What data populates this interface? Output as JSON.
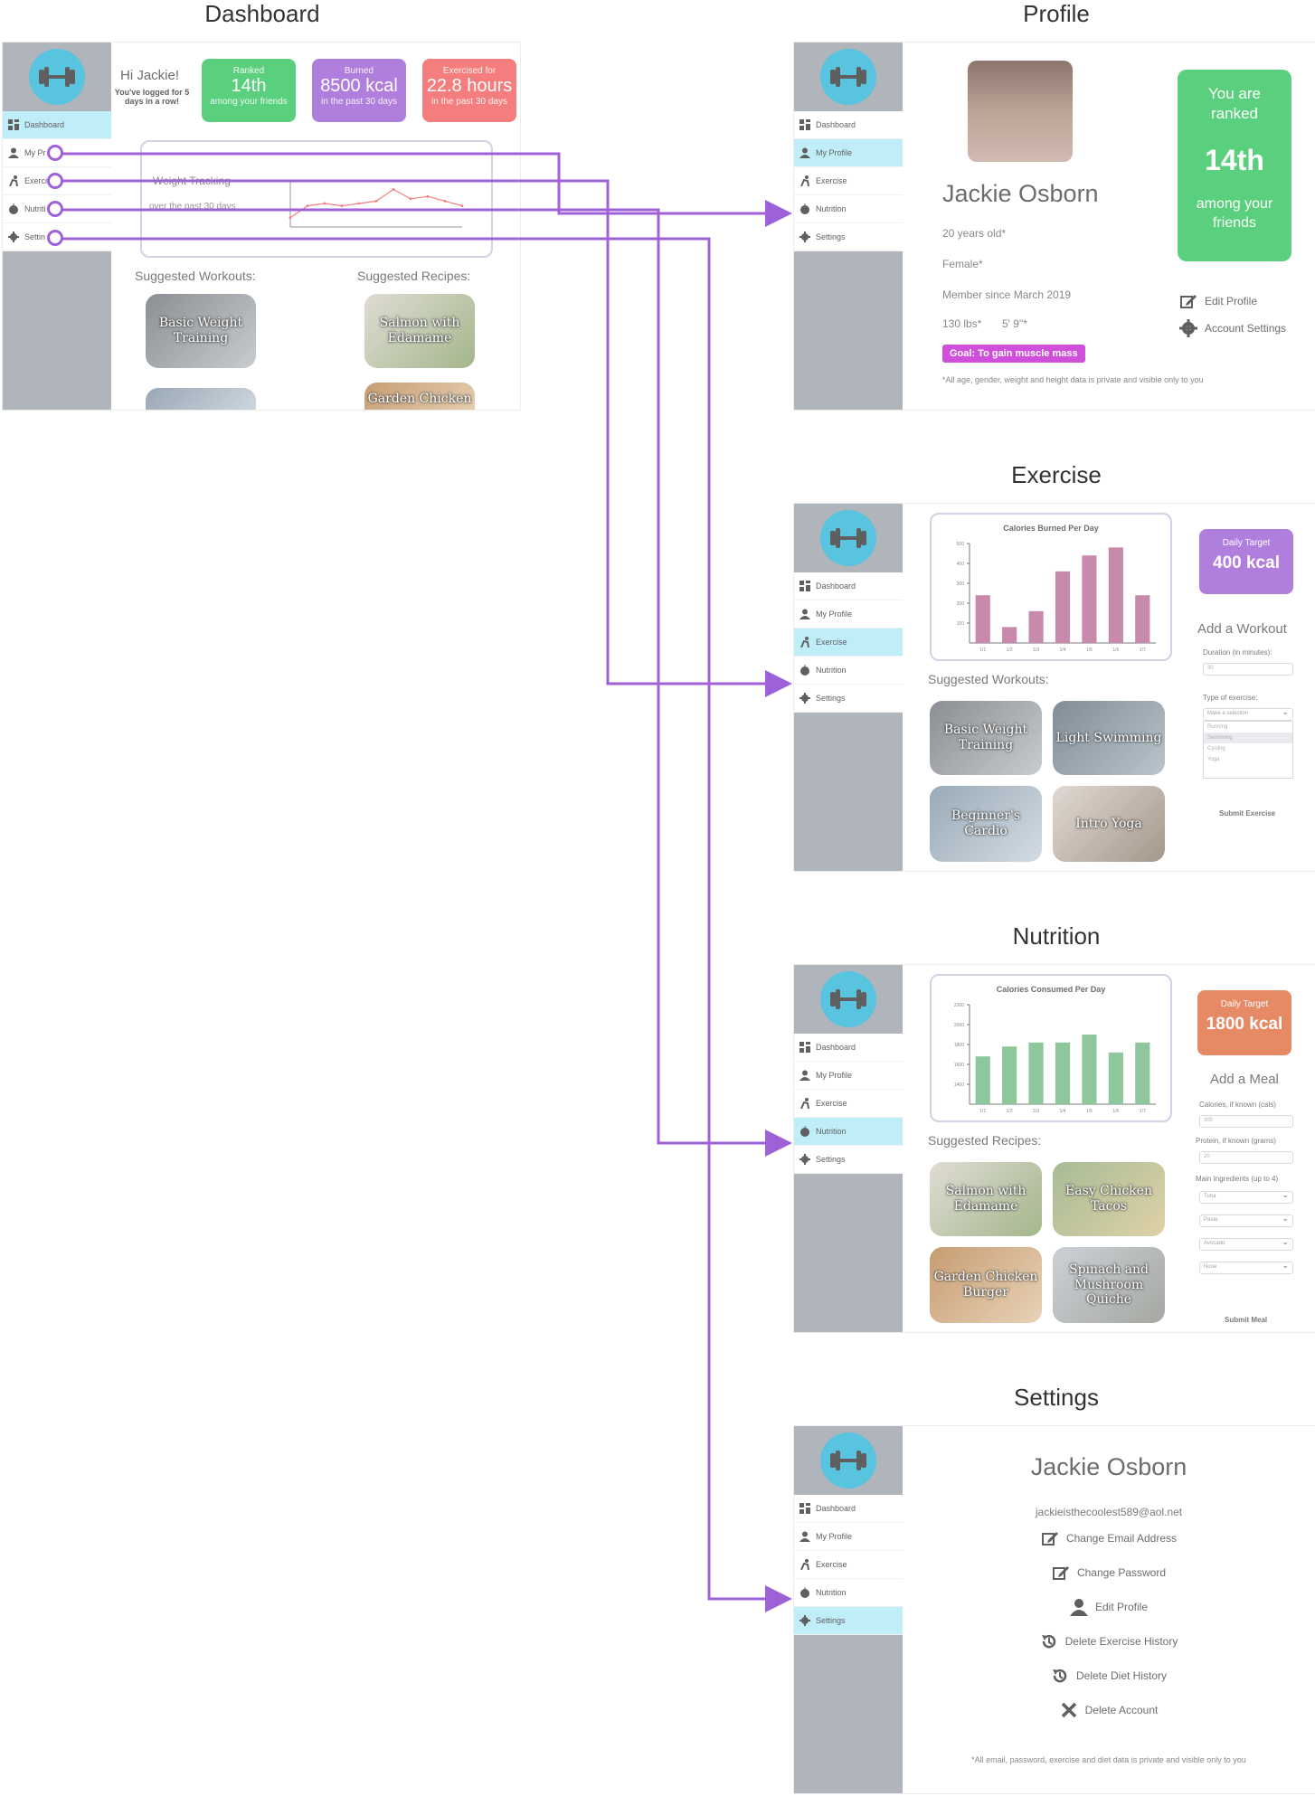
{
  "titles": {
    "dashboard": "Dashboard",
    "profile": "Profile",
    "exercise": "Exercise",
    "nutrition": "Nutrition",
    "settings": "Settings"
  },
  "nav": {
    "dashboard": "Dashboard",
    "profile": "My Profile",
    "exercise": "Exercise",
    "nutrition": "Nutrition",
    "settings": "Settings",
    "short_profile": "My Pr",
    "short_exercise": "Exerci",
    "short_nutrition": "Nutriti",
    "short_settings": "Settin"
  },
  "icons": [
    "dumbbell-icon",
    "dashboard-icon",
    "user-icon",
    "exercise-icon",
    "apple-icon",
    "gear-icon",
    "edit-icon",
    "history-icon",
    "close-icon"
  ],
  "colors": {
    "green": "#2cc45a",
    "purple": "#9a5ad4",
    "red": "#f25a5a",
    "blue": "#2ab4d8",
    "magenta": "#c21ed0",
    "orange": "#e06a3c",
    "bar_purple": "#b86a96",
    "bar_green": "#6fb880",
    "connector": "#a060d8"
  },
  "dashboard": {
    "greeting": "Hi Jackie!",
    "logged": "You've logged for 5 days in a row!",
    "card1": {
      "small": "Ranked",
      "big": "14th",
      "sub": "among your friends"
    },
    "card2": {
      "small": "Burned",
      "big": "8500 kcal",
      "sub": "in the past 30 days"
    },
    "card3": {
      "small": "Exercised for",
      "big": "22.8 hours",
      "sub": "in the past 30 days"
    },
    "weight_title": "Weight Tracking",
    "weight_sub": "over the past 30 days",
    "suggested_workouts": "Suggested Workouts:",
    "suggested_recipes": "Suggested Recipes:",
    "workout1": "Basic Weight Training",
    "recipe1": "Salmon with Edamame",
    "recipe2": "Garden Chicken"
  },
  "profile": {
    "name": "Jackie Osborn",
    "age": "20 years old*",
    "gender": "Female*",
    "member": "Member since March 2019",
    "weight": "130 lbs*",
    "height": "5' 9\"*",
    "goal": "Goal:  To gain muscle mass",
    "disclaimer": "*All age, gender, weight and height data is private and visible only to you",
    "rank_top": "You are ranked",
    "rank_big": "14th",
    "rank_bottom": "among your friends",
    "edit_profile": "Edit Profile",
    "account_settings": "Account Settings"
  },
  "exercise": {
    "chart_title": "Calories Burned Per Day",
    "suggested": "Suggested Workouts:",
    "target_small": "Daily Target",
    "target_big": "400 kcal",
    "add_title": "Add a Workout",
    "duration_label": "Duration (in minutes):",
    "duration_value": "30",
    "type_label": "Type of exercise:",
    "type_select": "Make a selection",
    "options": [
      "Running",
      "Swimming",
      "Cycling",
      "Yoga"
    ],
    "submit": "Submit Exercise",
    "workouts": [
      "Basic Weight Training",
      "Light Swimming",
      "Beginner's Cardio",
      "Intro Yoga"
    ]
  },
  "nutrition": {
    "chart_title": "Calories Consumed Per Day",
    "suggested": "Suggested Recipes:",
    "target_small": "Daily Target",
    "target_big": "1800 kcal",
    "add_title": "Add a Meal",
    "cal_label": "Calories, if known (cals)",
    "cal_value": "300",
    "protein_label": "Protein, if known (grams)",
    "protein_value": "20",
    "ing_label": "Main Ingredients (up to 4)",
    "ingredients": [
      "Tuna",
      "Pasta",
      "Avocado",
      "None"
    ],
    "submit": "Submit Meal",
    "recipes": [
      "Salmon with Edamame",
      "Easy Chicken Tacos",
      "Garden Chicken Burger",
      "Spinach and Mushroom Quiche"
    ]
  },
  "settings": {
    "name": "Jackie Osborn",
    "email": "jackieisthecoolest589@aol.net",
    "change_email": "Change Email Address",
    "change_password": "Change Password",
    "edit_profile": "Edit Profile",
    "delete_exercise": "Delete Exercise History",
    "delete_diet": "Delete Diet History",
    "delete_account": "Delete Account",
    "disclaimer": "*All email, password, exercise and diet data is private and visible only to you"
  },
  "chart_data": [
    {
      "type": "bar",
      "title": "Calories Burned Per Day",
      "categories": [
        "1/1",
        "1/2",
        "1/3",
        "1/4",
        "1/5",
        "1/6",
        "1/7"
      ],
      "values": [
        240,
        80,
        160,
        360,
        440,
        480,
        240
      ],
      "ylim": [
        0,
        500
      ],
      "yticks": [
        100,
        200,
        300,
        400,
        500
      ]
    },
    {
      "type": "bar",
      "title": "Calories Consumed Per Day",
      "categories": [
        "1/1",
        "1/2",
        "1/3",
        "1/4",
        "1/5",
        "1/6",
        "1/7"
      ],
      "values": [
        1680,
        1780,
        1820,
        1820,
        1900,
        1720,
        1820
      ],
      "ylim": [
        1200,
        2200
      ],
      "yticks": [
        1400,
        1600,
        1800,
        2000,
        2200
      ]
    },
    {
      "type": "line",
      "title": "Weight Tracking",
      "x": [
        0,
        1,
        2,
        3,
        4,
        5,
        6,
        7,
        8,
        9,
        10
      ],
      "values": [
        0.2,
        0.45,
        0.5,
        0.45,
        0.5,
        0.55,
        0.8,
        0.6,
        0.65,
        0.55,
        0.45
      ]
    }
  ]
}
